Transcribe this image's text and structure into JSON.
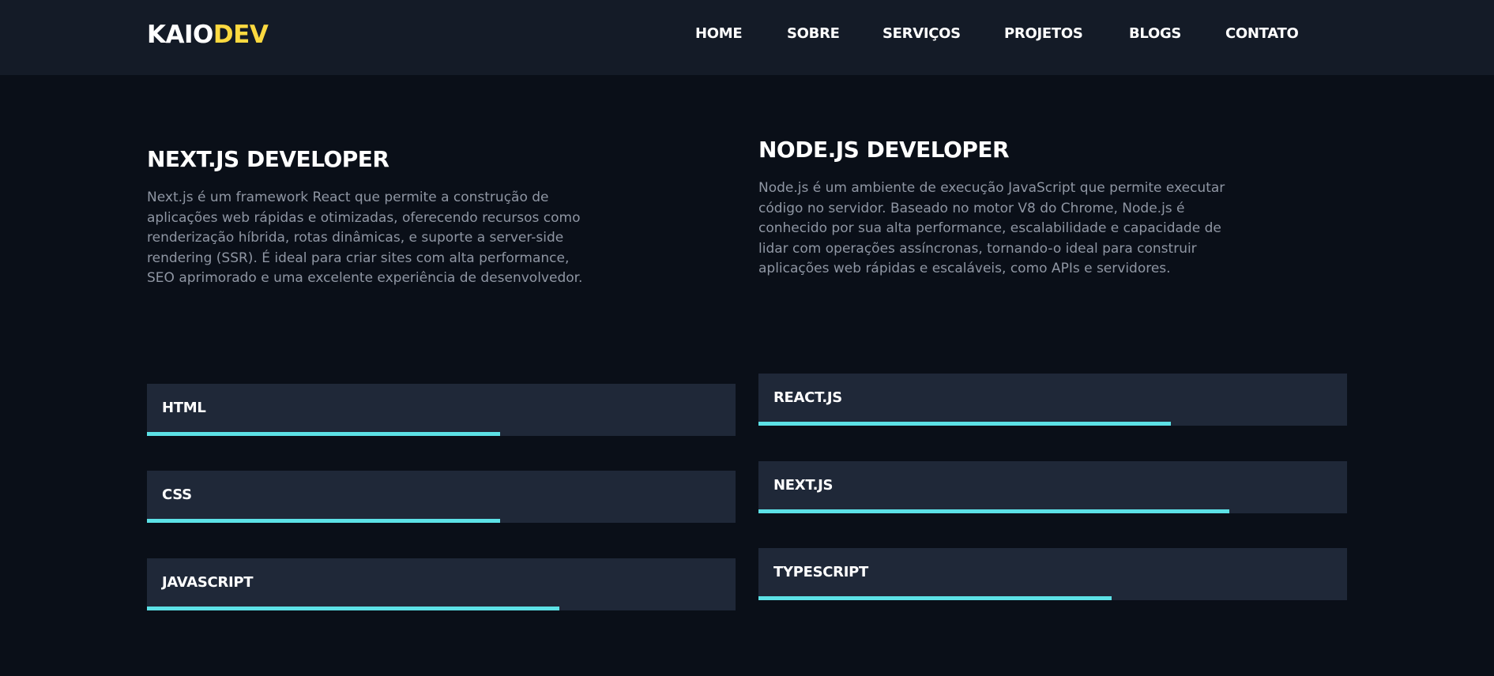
{
  "header": {
    "logo_main": "KAIO",
    "logo_accent": "DEV",
    "nav": [
      "HOME",
      "SOBRE",
      "SERVIÇOS",
      "PROJETOS",
      "BLOGS",
      "CONTATO"
    ]
  },
  "left": {
    "title": "NEXT.JS DEVELOPER",
    "description": "Next.js é um framework React que permite a construção de aplicações web rápidas e otimizadas, oferecendo recursos como renderização híbrida, rotas dinâmicas, e suporte a server-side rendering (SSR). É ideal para criar sites com alta performance, SEO aprimorado e uma excelente experiência de desenvolvedor.",
    "skills": [
      {
        "label": "HTML",
        "level": 0.6
      },
      {
        "label": "CSS",
        "level": 0.6
      },
      {
        "label": "JAVASCRIPT",
        "level": 0.7
      }
    ]
  },
  "right": {
    "title": "NODE.JS DEVELOPER",
    "description": "Node.js é um ambiente de execução JavaScript que permite executar código no servidor. Baseado no motor V8 do Chrome, Node.js é conhecido por sua alta performance, escalabilidade e capacidade de lidar com operações assíncronas, tornando-o ideal para construir aplicações web rápidas e escaláveis, como APIs e servidores.",
    "skills": [
      {
        "label": "REACT.JS",
        "level": 0.7
      },
      {
        "label": "NEXT.JS",
        "level": 0.8
      },
      {
        "label": "TYPESCRIPT",
        "level": 0.6
      }
    ]
  },
  "colors": {
    "background": "#0a0f18",
    "navbar": "#141b27",
    "accent": "#fcd940",
    "bar": "#5ce1e6",
    "skill_bg": "#1f2838"
  }
}
